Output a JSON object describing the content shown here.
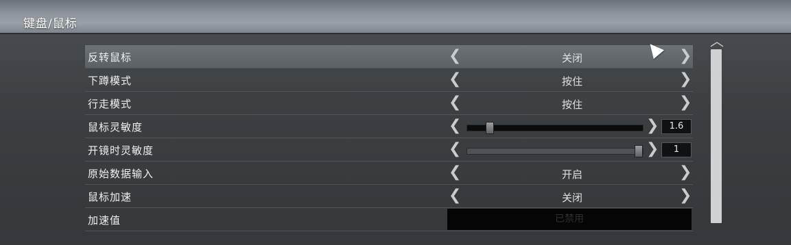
{
  "header": {
    "title": "键盘/鼠标"
  },
  "rows": [
    {
      "label": "反转鼠标",
      "value": "关闭"
    },
    {
      "label": "下蹲模式",
      "value": "按住"
    },
    {
      "label": "行走模式",
      "value": "按住"
    },
    {
      "label": "鼠标灵敏度",
      "value": "1.6",
      "slider_fraction": 0.11
    },
    {
      "label": "开镜时灵敏度",
      "value": "1",
      "slider_fraction": 1.0
    },
    {
      "label": "原始数据输入",
      "value": "开启"
    },
    {
      "label": "鼠标加速",
      "value": "关闭"
    },
    {
      "label": "加速值",
      "value": "已禁用"
    }
  ],
  "icons": {
    "left_arrow": "❮",
    "right_arrow": "❯",
    "scroll_up": "︿"
  }
}
